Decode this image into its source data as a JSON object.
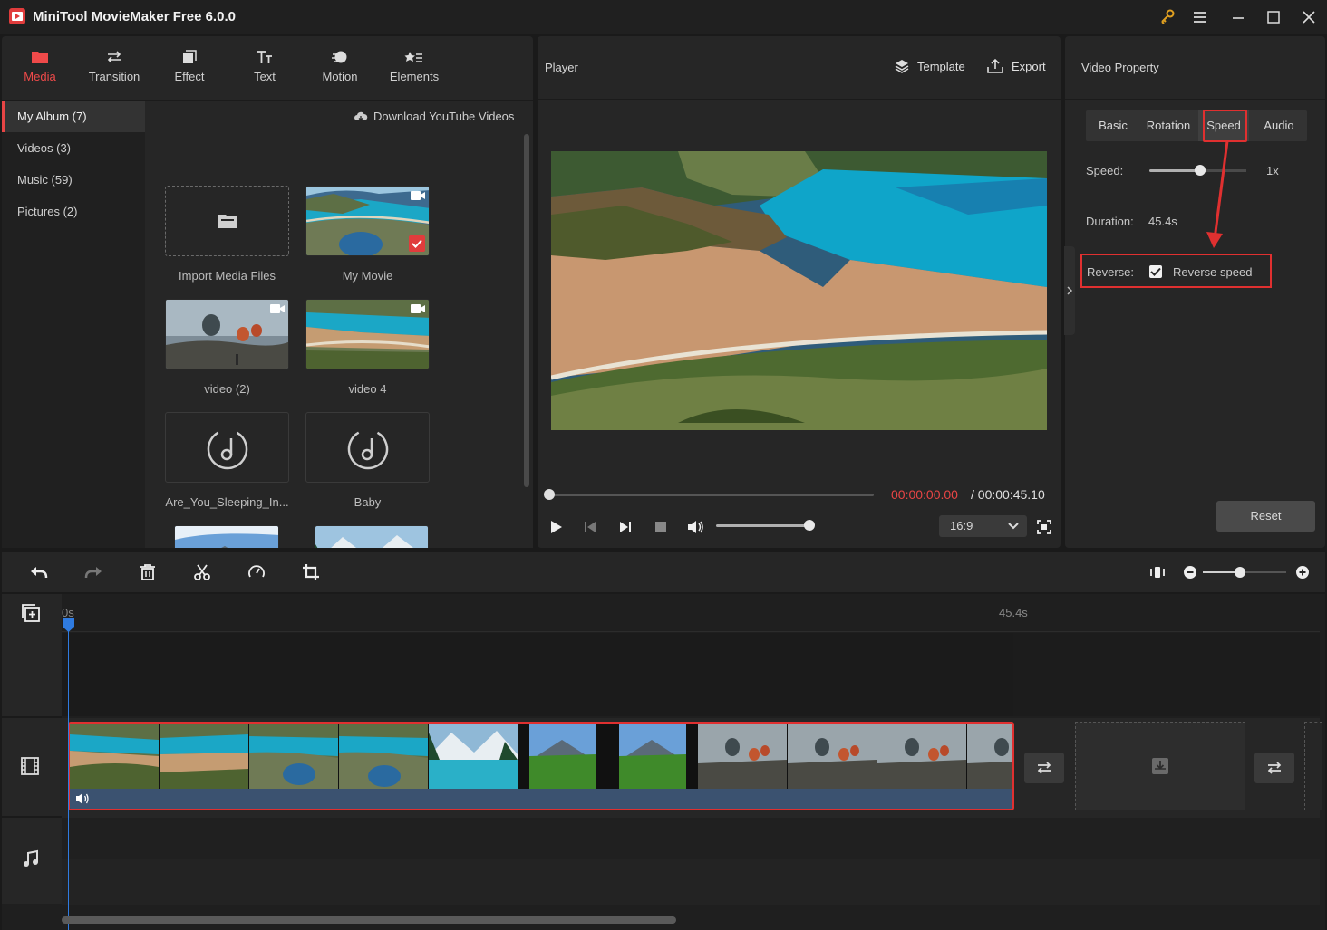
{
  "app": {
    "title": "MiniTool MovieMaker Free 6.0.0"
  },
  "toolbar": {
    "items": [
      {
        "label": "Media",
        "icon": "folder-icon",
        "active": true
      },
      {
        "label": "Transition",
        "icon": "transition-icon"
      },
      {
        "label": "Effect",
        "icon": "effect-icon"
      },
      {
        "label": "Text",
        "icon": "text-icon"
      },
      {
        "label": "Motion",
        "icon": "motion-icon"
      },
      {
        "label": "Elements",
        "icon": "elements-icon"
      }
    ]
  },
  "album_nav": {
    "items": [
      {
        "label": "My Album (7)",
        "active": true
      },
      {
        "label": "Videos (3)"
      },
      {
        "label": "Music (59)"
      },
      {
        "label": "Pictures (2)"
      }
    ]
  },
  "media": {
    "download_link": "Download YouTube Videos",
    "cards": [
      {
        "label": "Import Media Files",
        "kind": "import"
      },
      {
        "label": "My Movie",
        "kind": "video",
        "selected": true
      },
      {
        "label": "video (2)",
        "kind": "video"
      },
      {
        "label": "video 4",
        "kind": "video"
      },
      {
        "label": "Are_You_Sleeping_In...",
        "kind": "music"
      },
      {
        "label": "Baby",
        "kind": "music"
      }
    ]
  },
  "player": {
    "title": "Player",
    "template_label": "Template",
    "export_label": "Export",
    "time_current": "00:00:00.00",
    "time_total": "/ 00:00:45.10",
    "aspect_ratio": "16:9"
  },
  "property": {
    "title": "Video Property",
    "tabs": [
      {
        "label": "Basic"
      },
      {
        "label": "Rotation"
      },
      {
        "label": "Speed",
        "active": true
      },
      {
        "label": "Audio"
      }
    ],
    "speed_label": "Speed:",
    "speed_value": "1x",
    "duration_label": "Duration:",
    "duration_value": "45.4s",
    "reverse_label": "Reverse:",
    "reverse_option": "Reverse speed",
    "reverse_checked": true,
    "reset_label": "Reset"
  },
  "timeline": {
    "start_mark": "0s",
    "end_mark": "45.4s"
  },
  "colors": {
    "accent_red": "#e84545",
    "highlight_red": "#e03030",
    "playhead_blue": "#2f7be0",
    "audio_strip": "#3b5270"
  }
}
